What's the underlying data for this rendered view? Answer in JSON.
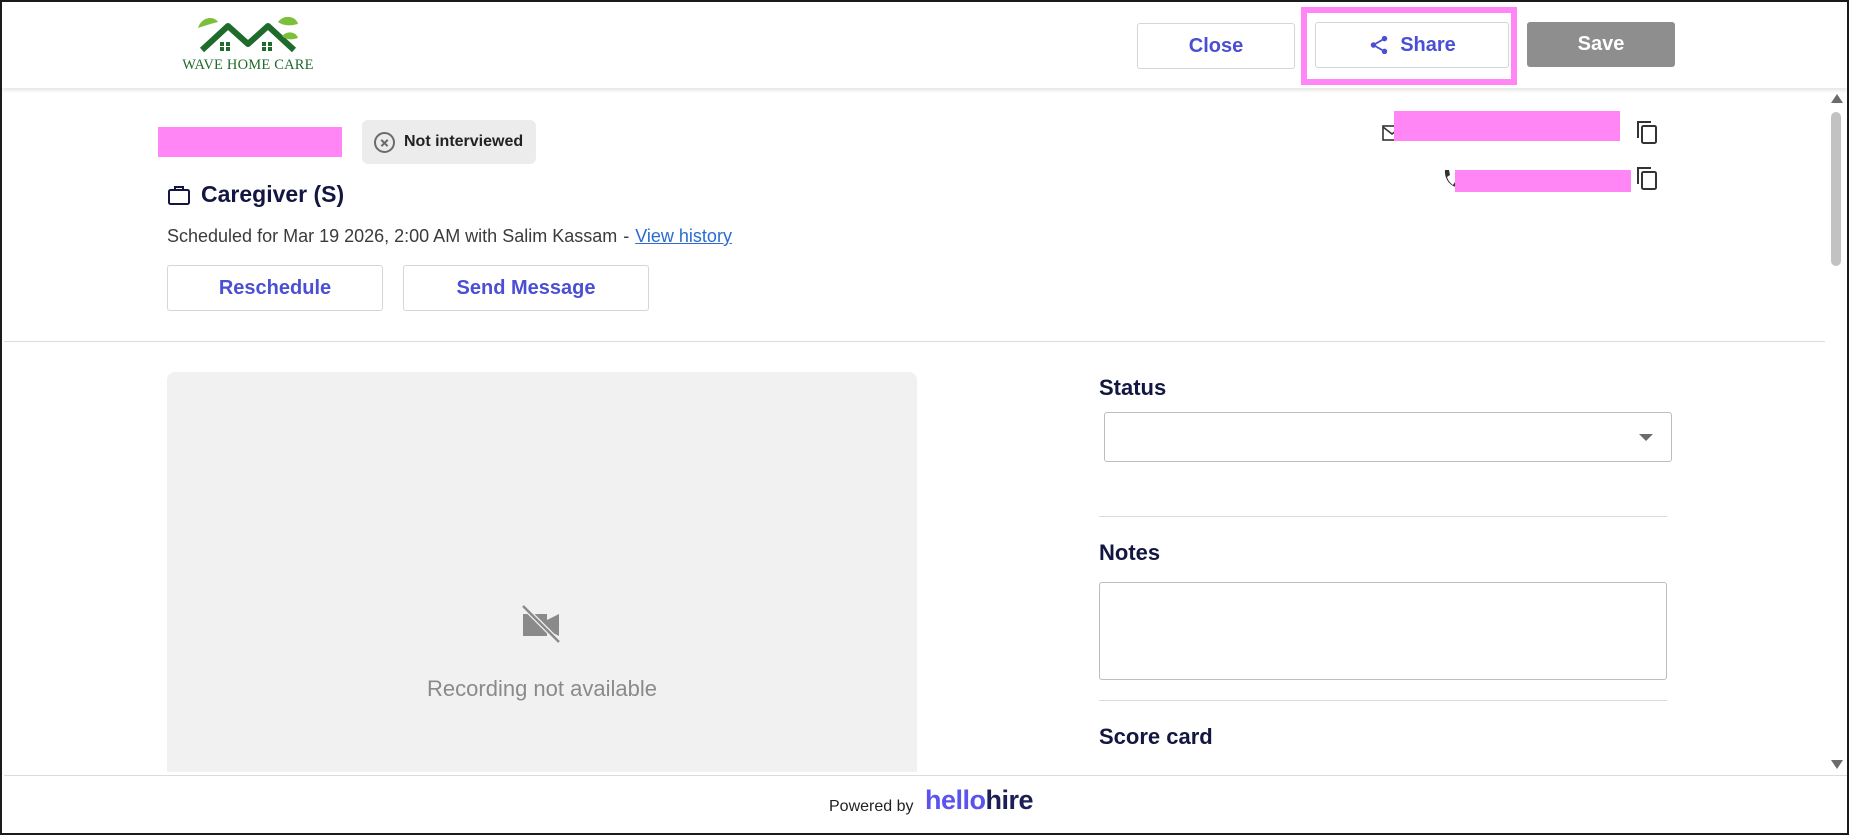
{
  "header": {
    "logo_text": "WAVE HOME CARE",
    "close_label": "Close",
    "share_label": "Share",
    "save_label": "Save"
  },
  "candidate": {
    "status_badge": "Not interviewed",
    "job_title": "Caregiver (S)",
    "schedule_text": "Scheduled for Mar 19 2026, 2:00 AM with Salim Kassam",
    "schedule_separator": "-",
    "view_history_label": "View history",
    "reschedule_label": "Reschedule",
    "send_message_label": "Send Message"
  },
  "recording": {
    "message": "Recording not available"
  },
  "panel": {
    "status_title": "Status",
    "status_value": "",
    "notes_title": "Notes",
    "notes_value": "",
    "scorecard_title": "Score card"
  },
  "footer": {
    "powered_by": "Powered by",
    "brand_hello": "hello",
    "brand_hire": "hire"
  },
  "colors": {
    "accent": "#4a4fd4",
    "link": "#2a6bd3",
    "save_disabled": "#8e8e8e",
    "redaction": "#ff86f4",
    "logo_green": "#1e6b2b"
  },
  "icons": [
    "logo-house-icon",
    "share-icon",
    "x-circle-icon",
    "briefcase-icon",
    "mail-icon",
    "phone-icon",
    "copy-icon",
    "video-off-icon",
    "chevron-down-icon"
  ]
}
